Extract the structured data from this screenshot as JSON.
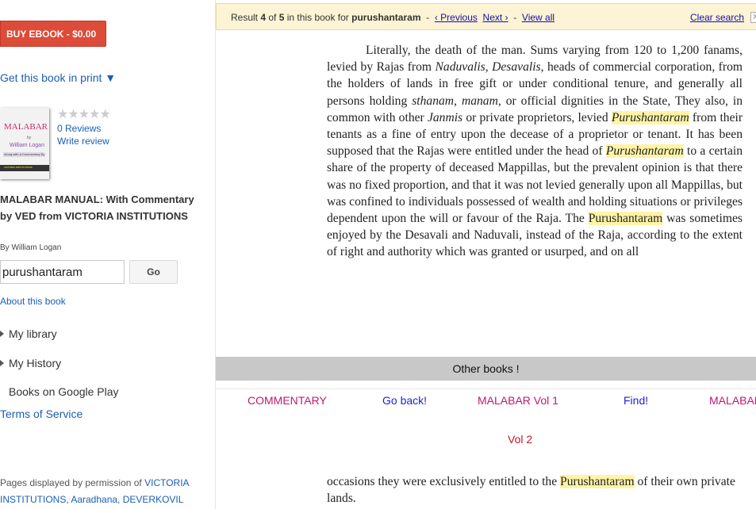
{
  "sidebar": {
    "buy_button": "BUY EBOOK - $0.00",
    "print_link": "Get this book in print ▼",
    "cover": {
      "title": "MALABAR",
      "by": "by",
      "author": "William Logan",
      "subtitle": "Along with a Commentary By",
      "strip": "VICTORIA INSTITUTIONS"
    },
    "rating": {
      "stars": "★★★★★",
      "filled": 0,
      "reviews": "0 Reviews",
      "write_review": "Write review"
    },
    "book_title": "MALABAR MANUAL: With Commentary by VED from VICTORIA INSTITUTIONS",
    "author": "By William Logan",
    "search": {
      "value": "purushantaram",
      "go_label": "Go"
    },
    "about": "About this book",
    "nav": [
      {
        "label": "My library",
        "expandable": true
      },
      {
        "label": "My History",
        "expandable": true
      },
      {
        "label": "Books on Google Play",
        "expandable": false
      }
    ],
    "terms": "Terms of Service",
    "permission_prefix": "Pages displayed by permission of ",
    "permission_link": "VICTORIA INSTITUTIONS, Aaradhana, DEVERKOVIL"
  },
  "result_bar": {
    "result_word": "Result ",
    "current": "4",
    "of_word": " of ",
    "total": "5",
    "in_book": " in this book for ",
    "query": "purushantaram",
    "sep1": "  -  ",
    "previous": "‹ Previous",
    "next": "Next ›",
    "sep2": "  -  ",
    "view_all": "View all",
    "clear": "Clear search",
    "close": "X"
  },
  "page": {
    "p1": "Literally, the death of the man. Sums varying from 120 to 1,200 fanams, levied by Rajas from ",
    "p1_i1": "Naduvalis",
    "p1_b": ", ",
    "p1_i2": "Desavalis",
    "p1_c": ", heads of commercial corporation, from the holders of lands in free gift or under conditional tenure, and generally all persons holding ",
    "p1_i3": "sthanam",
    "p1_d": ", ",
    "p1_i4": "manam",
    "p1_e": ", or official dignities in the State, They also, in common with other ",
    "p1_i5": "Janmis",
    "p1_f": " or private proprietors, levied ",
    "p1_h1": "Purushantaram",
    "p1_g": " from their tenants as a fine of entry upon the decease of a proprietor or tenant. It has been supposed that the Rajas were entitled under the head of ",
    "p1_h2": "Purushantaram",
    "p1_h": " to a certain share of the property of deceased Mappillas, but the prevalent opinion is that there was no fixed proportion, and that it was not levied generally upon all Mappillas, but was confined to individuals possessed of wealth and holding situations or privileges dependent upon the will or favour of the Raja. The ",
    "p1_h3": "Purushantaram",
    "p1_i": " was sometimes enjoyed by the Desavali and Naduvali, instead of the Raja, according to the extent of right and authority which was granted or usurped, and on all"
  },
  "other_books": "Other books !",
  "links": [
    {
      "label": "COMMENTARY",
      "color": "#c0186e"
    },
    {
      "label": "Go back!",
      "color": "#1d1ddb"
    },
    {
      "label": "MALABAR Vol 1",
      "color": "#c0186e"
    },
    {
      "label": "Find!",
      "color": "#1d1ddb"
    },
    {
      "label": "MALABAR",
      "color": "#c0186e"
    }
  ],
  "vol2": "Vol 2",
  "lower": {
    "a": "occasions they were exclusively entitled to the ",
    "h": "Purushantaram",
    "b": " of their own private lands."
  }
}
